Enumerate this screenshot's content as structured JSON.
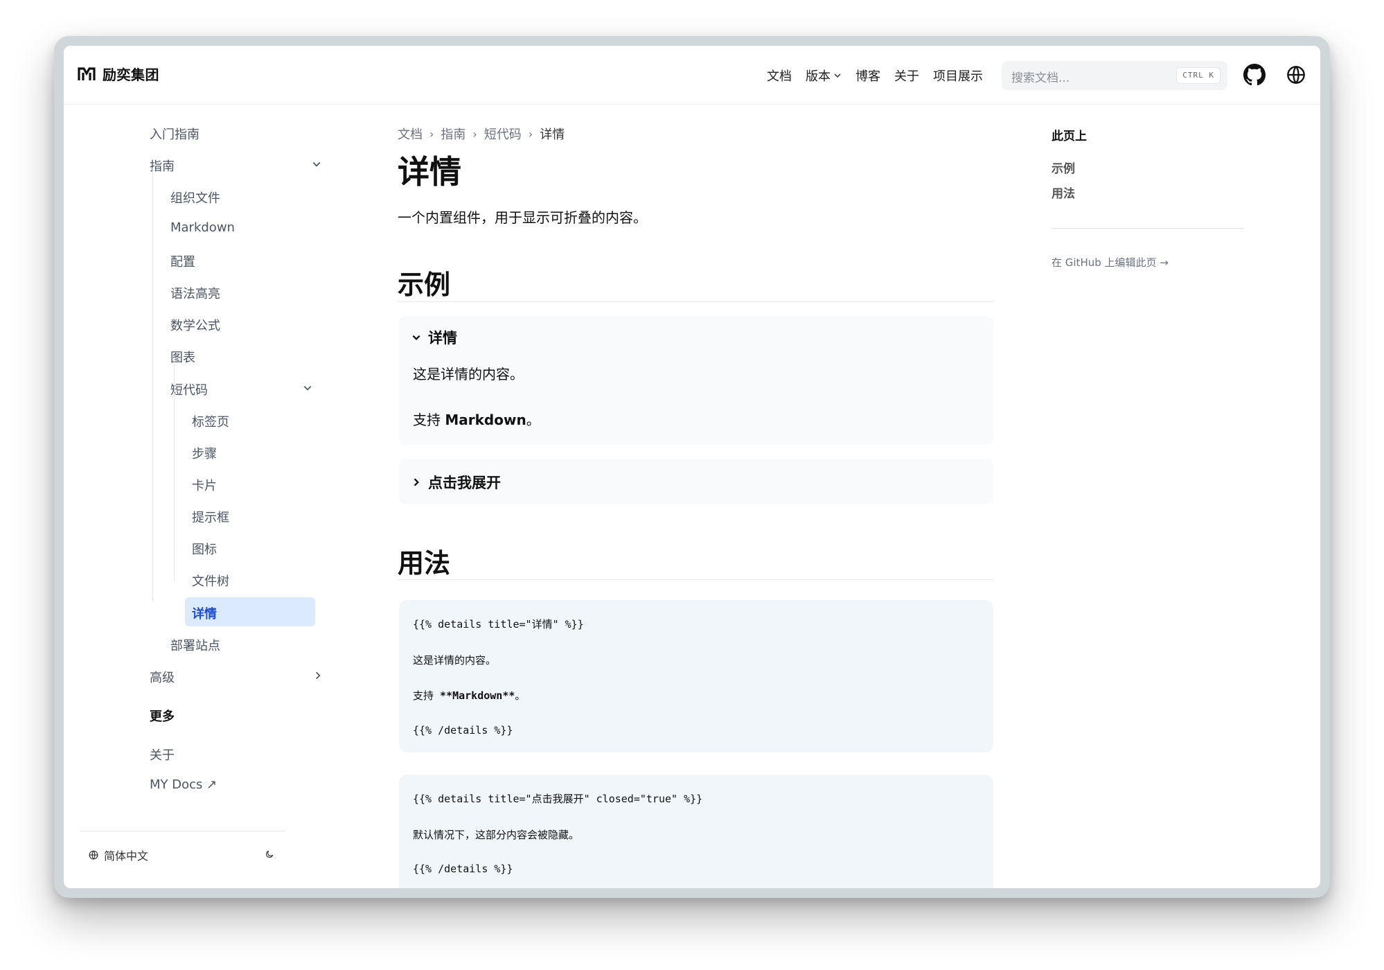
{
  "brand": {
    "name": "励奕集团"
  },
  "nav": {
    "docs": "文档",
    "versions": "版本",
    "blog": "博客",
    "about": "关于",
    "showcase": "项目展示"
  },
  "search": {
    "placeholder": "搜索文档...",
    "shortcut": "CTRL K"
  },
  "sidebar": {
    "getting_started": "入门指南",
    "guide": "指南",
    "guide_items": {
      "organize": "组织文件",
      "markdown": "Markdown",
      "config": "配置",
      "syntax": "语法高亮",
      "math": "数学公式",
      "charts": "图表",
      "shortcodes": "短代码"
    },
    "shortcode_items": {
      "tabs": "标签页",
      "steps": "步骤",
      "cards": "卡片",
      "callout": "提示框",
      "icons": "图标",
      "filetree": "文件树",
      "details": "详情"
    },
    "deploy": "部署站点",
    "advanced": "高级",
    "more_heading": "更多",
    "about": "关于",
    "mydocs": "MY Docs ↗",
    "language": "简体中文"
  },
  "breadcrumb": [
    "文档",
    "指南",
    "短代码",
    "详情"
  ],
  "page": {
    "title": "详情",
    "lead": "一个内置组件，用于显示可折叠的内容。",
    "section_example": "示例",
    "section_usage": "用法"
  },
  "example": {
    "details1_summary": "详情",
    "details1_p1": "这是详情的内容。",
    "details1_p2_prefix": "支持 ",
    "details1_p2_bold": "Markdown",
    "details1_p2_suffix": "。",
    "details2_summary": "点击我展开"
  },
  "code1": {
    "line1": "{{% details title=\"详情\" %}}",
    "line2": "这是详情的内容。",
    "line3_prefix": "支持 ",
    "line3_bold": "**Markdown**",
    "line3_suffix": "。",
    "line4": "{{% /details %}}"
  },
  "code2": {
    "line1": "{{% details title=\"点击我展开\" closed=\"true\" %}}",
    "line2": "默认情况下，这部分内容会被隐藏。",
    "line3": "{{% /details %}}"
  },
  "toc": {
    "title": "此页上",
    "items": [
      "示例",
      "用法"
    ],
    "edit": "在 GitHub 上编辑此页 →"
  },
  "colors": {
    "active_bg": "#dbeafe",
    "active_text": "#1d4ed8",
    "code_bg": "#f1f6fb",
    "details_bg": "#f9fafb"
  }
}
